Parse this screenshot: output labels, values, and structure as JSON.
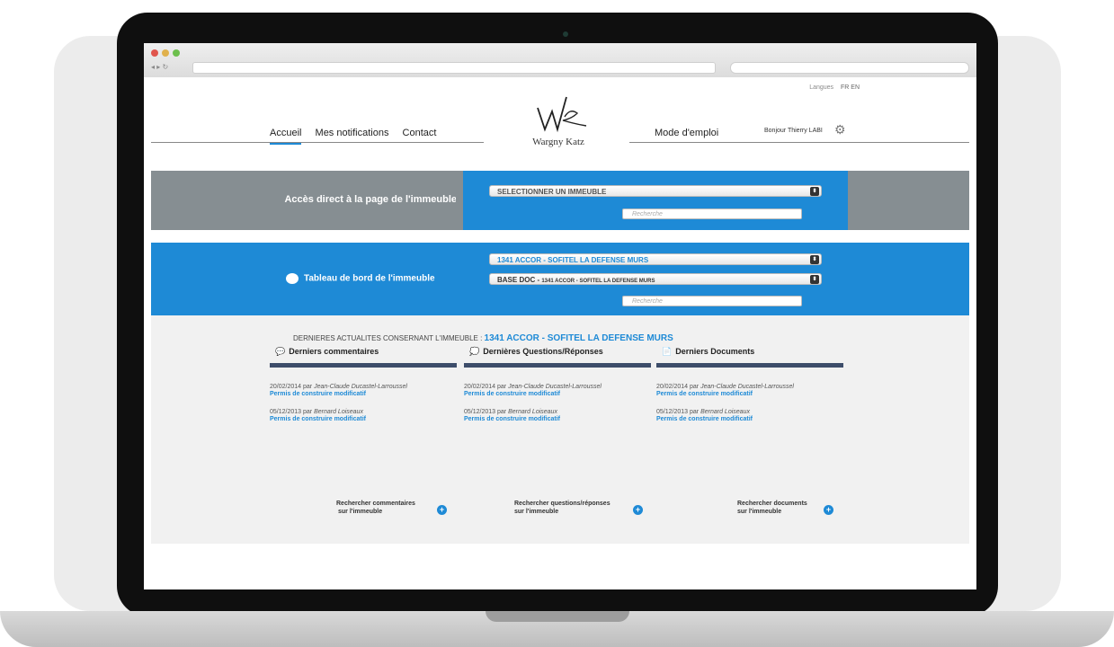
{
  "header": {
    "languages_label": "Langues",
    "language_codes": "FR EN",
    "nav": [
      "Accueil",
      "Mes notifications",
      "Contact"
    ],
    "logo_text": "Wargny Katz",
    "mode_emploi": "Mode d'emploi",
    "greeting": "Bonjour Thierry LABI"
  },
  "access": {
    "label": "Accès direct à la page de l'immeuble",
    "select_value": "SELECTIONNER UN IMMEUBLE",
    "search_placeholder": "Recherche"
  },
  "dashboard": {
    "label": "Tableau de bord de l'immeuble",
    "select_building": "1341 ACCOR - SOFITEL LA  DEFENSE MURS",
    "select_base_prefix": "BASE DOC - ",
    "select_base_building": "1341 ACCOR - SOFITEL LA DEFENSE MURS",
    "search_placeholder": "Recherche"
  },
  "news": {
    "prefix": "DERNIERES ACTUALITES CONSERNANT L'IMMEUBLE : ",
    "building": "1341 ACCOR - SOFITEL LA  DEFENSE MURS"
  },
  "columns": [
    {
      "title": "Derniers commentaires",
      "icon": "comment-icon",
      "items": [
        {
          "date": "20/02/2014",
          "by": "par",
          "author": "Jean-Claude Ducastel-Larroussel",
          "link": "Permis de construire modificatif"
        },
        {
          "date": "05/12/2013",
          "by": "par",
          "author": "Bernard Loiseaux",
          "link": "Permis de construire modificatif"
        }
      ],
      "more": [
        "Rechercher commentaires",
        "sur l'immeuble"
      ]
    },
    {
      "title": "Dernières Questions/Réponses",
      "icon": "questions-icon",
      "items": [
        {
          "date": "20/02/2014",
          "by": "par",
          "author": "Jean-Claude Ducastel-Larroussel",
          "link": "Permis de construire modificatif"
        },
        {
          "date": "05/12/2013",
          "by": "par",
          "author": "Bernard Loiseaux",
          "link": "Permis de construire modificatif"
        }
      ],
      "more": [
        "Rechercher questions/réponses",
        "sur l'immeuble"
      ]
    },
    {
      "title": "Derniers Documents",
      "icon": "documents-icon",
      "items": [
        {
          "date": "20/02/2014",
          "by": "par",
          "author": "Jean-Claude Ducastel-Larroussel",
          "link": "Permis de construire modificatif"
        },
        {
          "date": "05/12/2013",
          "by": "par",
          "author": "Bernard Loiseaux",
          "link": "Permis de construire modificatif"
        }
      ],
      "more": [
        "Rechercher documents",
        "sur l'immeuble"
      ]
    }
  ],
  "colors": {
    "accent": "#1e8ad6",
    "band_grey": "#868e92",
    "dark_bar": "#3d4d6a"
  }
}
